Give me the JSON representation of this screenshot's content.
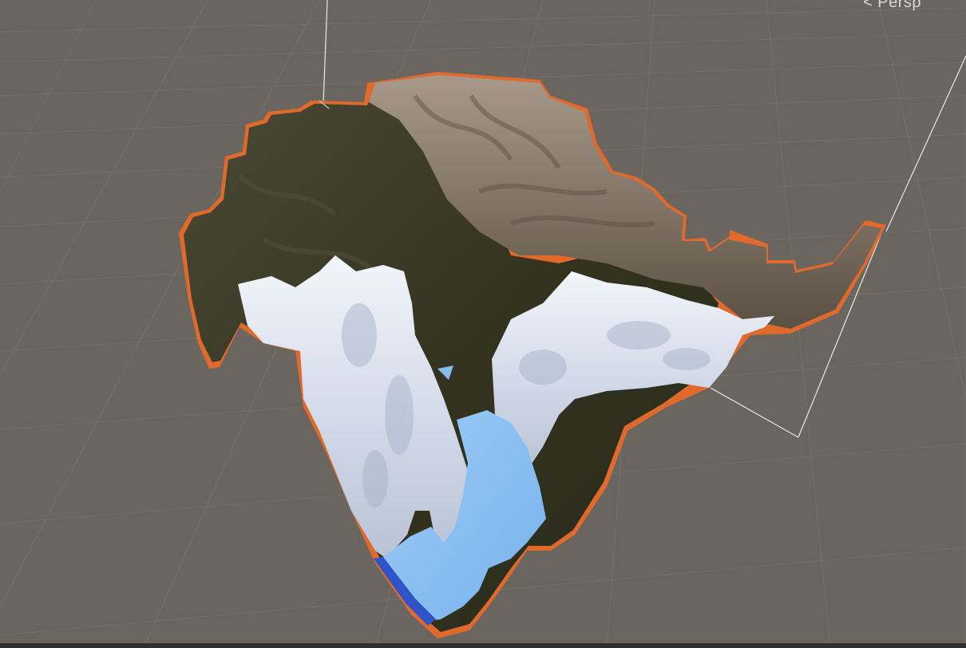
{
  "scene": {
    "view_mode_label": "Persp",
    "view_mode_icon": "chevron-left-icon"
  },
  "colors": {
    "background": "#6b6560",
    "grid_line": "#7a746e",
    "selection_outline": "#e06a2c",
    "bounds_box": "#e8e8e8",
    "terrain_dark": "#3d3c2e",
    "terrain_rock": "#8a7c6c",
    "snow": "#e6ecf5",
    "water": "#87bdf2"
  }
}
